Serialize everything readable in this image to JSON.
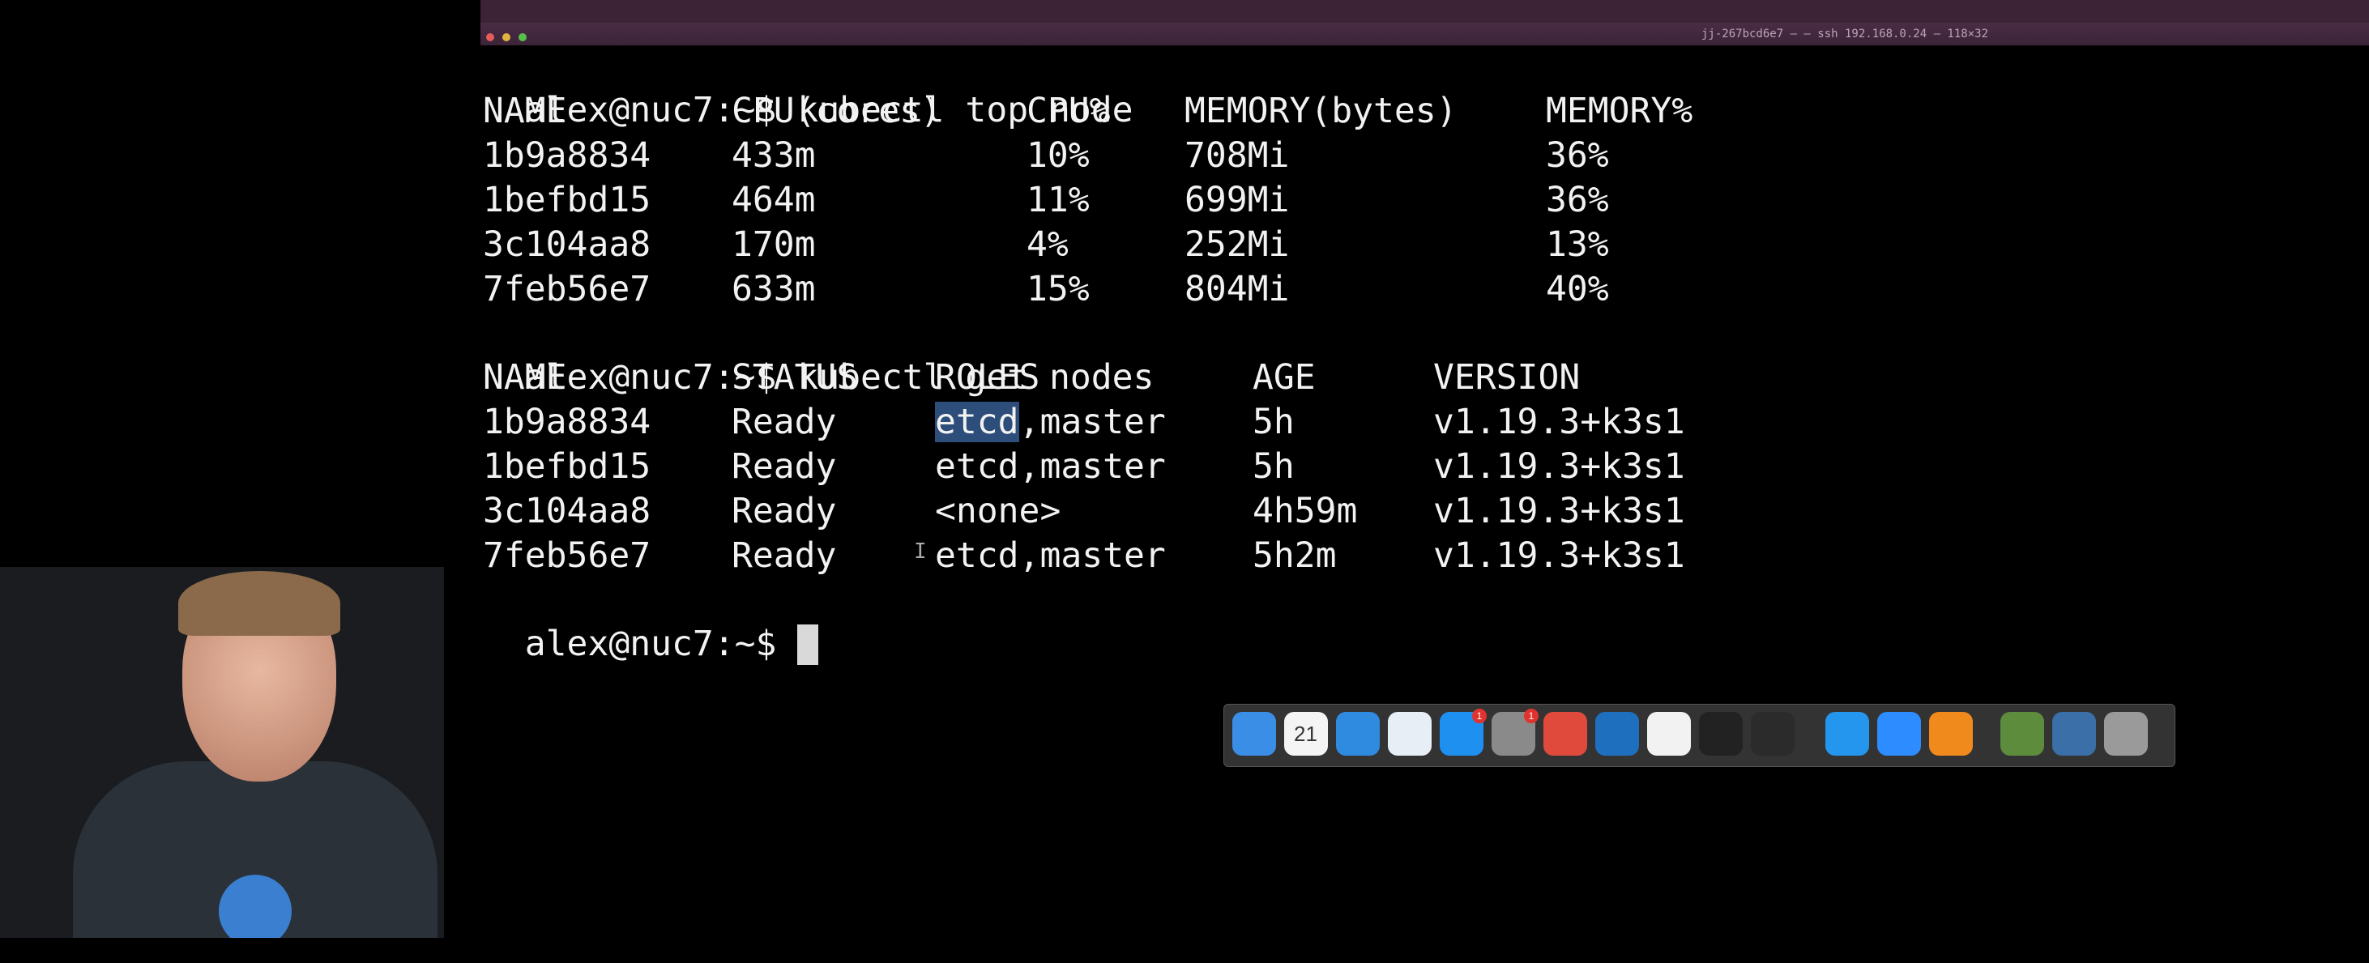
{
  "window": {
    "title": "jj-267bcd6e7 — — ssh 192.168.0.24 — 118×32",
    "lights": [
      "#e35d5b",
      "#e3b341",
      "#58c14a"
    ]
  },
  "prompt": "alex@nuc7:~$ ",
  "cmd1": "kubectl top node",
  "cmd2": "kubectl get nodes",
  "top": {
    "headers": [
      "NAME",
      "CPU(cores)",
      "CPU%",
      "MEMORY(bytes)",
      "MEMORY%"
    ],
    "rows": [
      [
        "1b9a8834",
        "433m",
        "10%",
        "708Mi",
        "36%"
      ],
      [
        "1befbd15",
        "464m",
        "11%",
        "699Mi",
        "36%"
      ],
      [
        "3c104aa8",
        "170m",
        "4%",
        "252Mi",
        "13%"
      ],
      [
        "7feb56e7",
        "633m",
        "15%",
        "804Mi",
        "40%"
      ]
    ]
  },
  "nodes": {
    "headers": [
      "NAME",
      "STATUS",
      "ROLES",
      "AGE",
      "VERSION"
    ],
    "rows": [
      [
        "1b9a8834",
        "Ready",
        "etcd",
        ",master",
        "5h",
        "v1.19.3+k3s1"
      ],
      [
        "1befbd15",
        "Ready",
        "etcd,master",
        "",
        "5h",
        "v1.19.3+k3s1"
      ],
      [
        "3c104aa8",
        "Ready",
        "<none>",
        "",
        "4h59m",
        "v1.19.3+k3s1"
      ],
      [
        "7feb56e7",
        "Ready",
        "etcd,master",
        "",
        "5h2m",
        "v1.19.3+k3s1"
      ]
    ]
  },
  "ibeam": "I",
  "dock": {
    "apps": [
      {
        "name": "finder-icon",
        "color": "#3a8ee6"
      },
      {
        "name": "calendar-icon",
        "color": "#f4f4f4",
        "text": "21"
      },
      {
        "name": "safari-icon",
        "color": "#2f8be0"
      },
      {
        "name": "keynote-icon",
        "color": "#e8eef6"
      },
      {
        "name": "app-store-icon",
        "color": "#1e90f0",
        "badge": "1"
      },
      {
        "name": "system-preferences-icon",
        "color": "#8a8a8a",
        "badge": "1"
      },
      {
        "name": "chrome-icon",
        "color": "#e04a3c"
      },
      {
        "name": "vscode-icon",
        "color": "#1f6fbf"
      },
      {
        "name": "slack-icon",
        "color": "#f2f2f2"
      },
      {
        "name": "terminal-icon",
        "color": "#222222"
      },
      {
        "name": "obs-icon",
        "color": "#2b2b2b"
      },
      {
        "name": "docker-icon",
        "color": "#2496ed"
      },
      {
        "name": "zoom-icon",
        "color": "#2d8cff"
      },
      {
        "name": "vlc-icon",
        "color": "#f08a1c"
      },
      {
        "name": "preview-icon",
        "color": "#5c8c3c"
      },
      {
        "name": "downloads-folder-icon",
        "color": "#3a6fa8"
      },
      {
        "name": "trash-icon",
        "color": "#9a9a9a"
      }
    ]
  },
  "webcam": {
    "logo": "kubernetes-icon"
  }
}
